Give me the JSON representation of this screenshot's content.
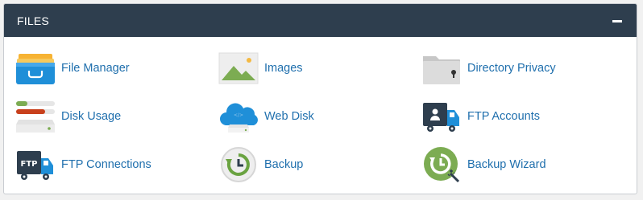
{
  "section": {
    "title": "FILES",
    "collapse_symbol": "minus-icon"
  },
  "items": [
    {
      "label": "File Manager",
      "icon": "file-manager-icon"
    },
    {
      "label": "Images",
      "icon": "images-icon"
    },
    {
      "label": "Directory Privacy",
      "icon": "directory-privacy-icon"
    },
    {
      "label": "Disk Usage",
      "icon": "disk-usage-icon"
    },
    {
      "label": "Web Disk",
      "icon": "web-disk-icon"
    },
    {
      "label": "FTP Accounts",
      "icon": "ftp-accounts-icon"
    },
    {
      "label": "FTP Connections",
      "icon": "ftp-connections-icon"
    },
    {
      "label": "Backup",
      "icon": "backup-icon"
    },
    {
      "label": "Backup Wizard",
      "icon": "backup-wizard-icon"
    }
  ],
  "ftp_connections_icon_text": "FTP",
  "colors": {
    "header_bg": "#2e3e4e",
    "link": "#1f6fad",
    "panel_bg": "#ffffff"
  }
}
